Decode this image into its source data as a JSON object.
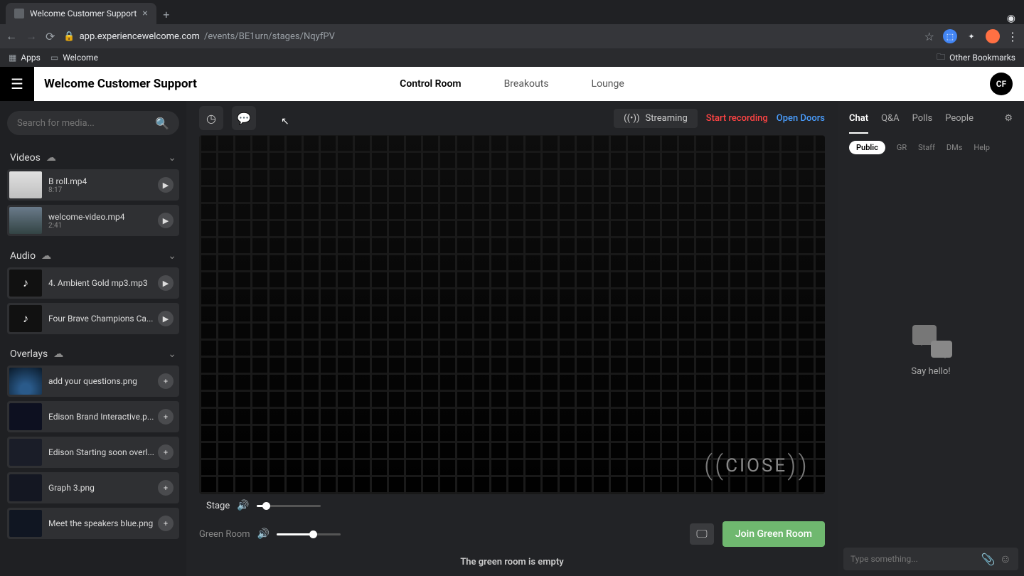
{
  "browser": {
    "tab_title": "Welcome Customer Support",
    "url_host": "app.experiencewelcome.com",
    "url_path": "/events/BE1urn/stages/NqyfPV",
    "apps_label": "Apps",
    "bookmark1": "Welcome",
    "other_bookmarks": "Other Bookmarks"
  },
  "header": {
    "title": "Welcome Customer Support",
    "nav": {
      "control_room": "Control Room",
      "breakouts": "Breakouts",
      "lounge": "Lounge"
    },
    "avatar_initials": "CF"
  },
  "sidebar": {
    "search_placeholder": "Search for media...",
    "sections": {
      "videos": "Videos",
      "audio": "Audio",
      "overlays": "Overlays"
    },
    "videos": [
      {
        "name": "B roll.mp4",
        "duration": "8:17"
      },
      {
        "name": "welcome-video.mp4",
        "duration": "2:41"
      }
    ],
    "audio": [
      {
        "name": "4. Ambient Gold mp3.mp3"
      },
      {
        "name": "Four Brave Champions Ca..."
      }
    ],
    "overlays": [
      {
        "name": "add your questions.png"
      },
      {
        "name": "Edison Brand Interactive.p..."
      },
      {
        "name": "Edison Starting soon overl..."
      },
      {
        "name": "Graph 3.png"
      },
      {
        "name": "Meet the speakers blue.png"
      }
    ]
  },
  "stage": {
    "streaming_label": "Streaming",
    "record_label": "Start recording",
    "doors_label": "Open Doors",
    "stage_label": "Stage",
    "greenroom_label": "Green Room",
    "join_label": "Join Green Room",
    "empty_label": "The green room is empty",
    "watermark": "CIOSE"
  },
  "chat": {
    "tabs": {
      "chat": "Chat",
      "qa": "Q&A",
      "polls": "Polls",
      "people": "People"
    },
    "subtabs": {
      "public": "Public",
      "gr": "GR",
      "staff": "Staff",
      "dms": "DMs",
      "help": "Help"
    },
    "empty": "Say hello!",
    "composer_placeholder": "Type something..."
  }
}
